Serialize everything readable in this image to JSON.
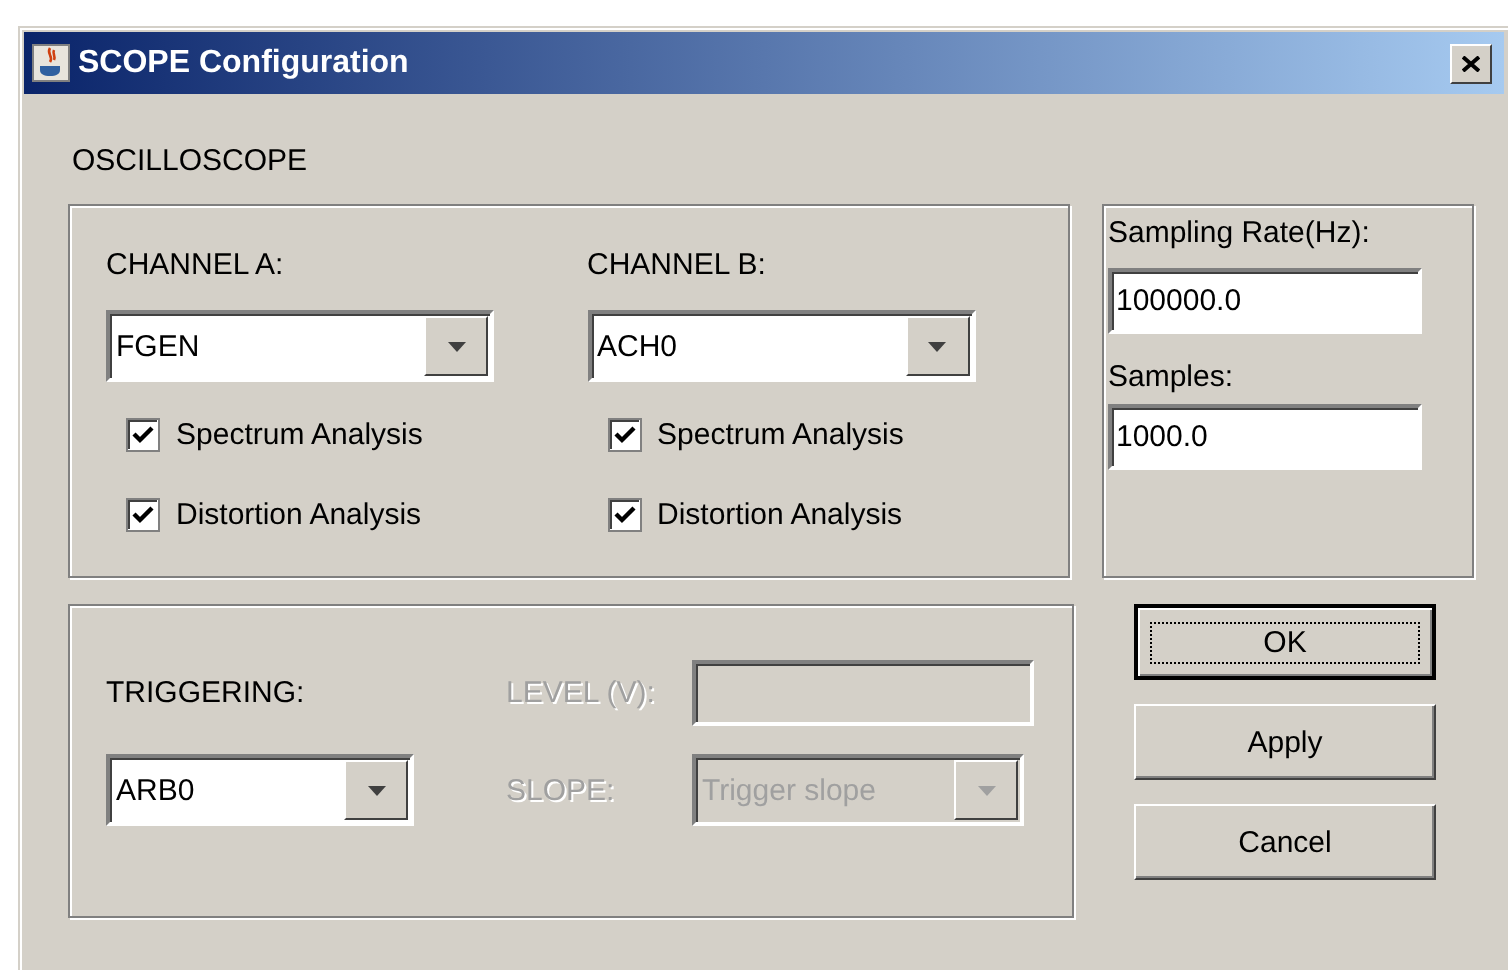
{
  "window": {
    "title": "SCOPE Configuration"
  },
  "section_label": "OSCILLOSCOPE",
  "channels": [
    {
      "label": "CHANNEL A:",
      "source": "FGEN",
      "options": [
        {
          "label": "Spectrum Analysis",
          "checked": true
        },
        {
          "label": "Distortion Analysis",
          "checked": true
        }
      ]
    },
    {
      "label": "CHANNEL B:",
      "source": "ACH0",
      "options": [
        {
          "label": "Spectrum Analysis",
          "checked": true
        },
        {
          "label": "Distortion Analysis",
          "checked": true
        }
      ]
    }
  ],
  "sampling": {
    "rate_label": "Sampling Rate(Hz):",
    "rate_value": "100000.0",
    "samples_label": "Samples:",
    "samples_value": "1000.0"
  },
  "triggering": {
    "label": "TRIGGERING:",
    "source": "ARB0",
    "level": {
      "label": "LEVEL (V):",
      "disabled": true
    },
    "slope": {
      "label": "SLOPE:",
      "value": "Trigger slope",
      "disabled": true
    }
  },
  "buttons": [
    {
      "label": "OK",
      "focused": true
    },
    {
      "label": "Apply",
      "focused": false
    },
    {
      "label": "Cancel",
      "focused": false
    }
  ]
}
